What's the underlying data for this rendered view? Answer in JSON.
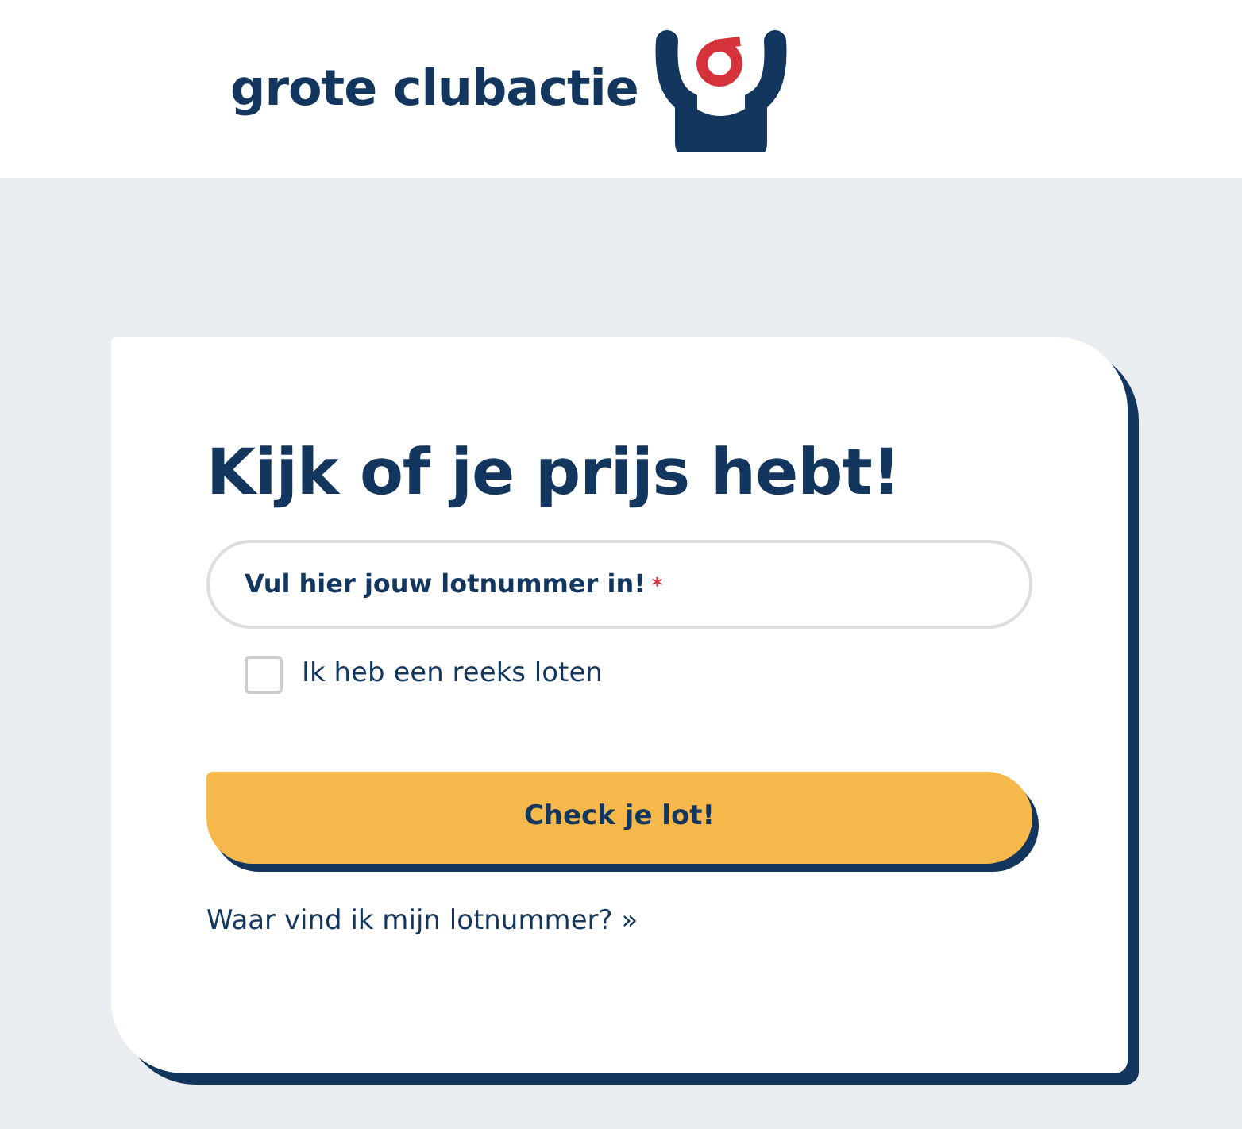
{
  "header": {
    "logo_text": "grote clubactie"
  },
  "card": {
    "title": "Kijk of je prijs hebt!",
    "field": {
      "label": "Vul hier jouw lotnummer in!",
      "required_mark": "*"
    },
    "checkbox": {
      "label": "Ik heb een reeks loten",
      "checked": false
    },
    "button": "Check je lot!",
    "link": {
      "text": "Waar vind ik mijn lotnummer?",
      "arrow": "»"
    }
  }
}
